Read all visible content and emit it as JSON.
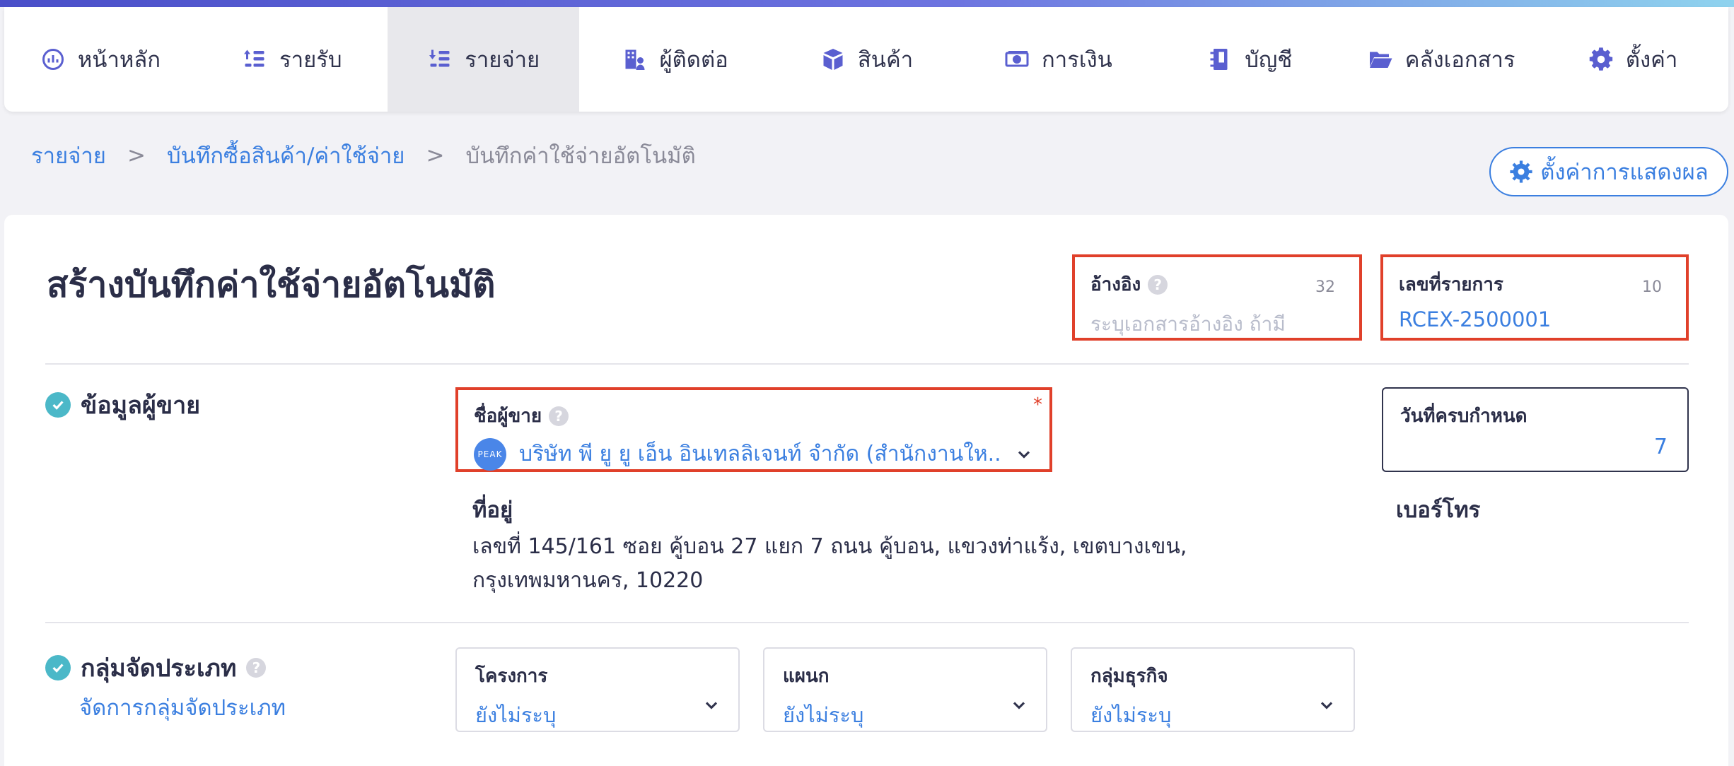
{
  "nav": {
    "items": [
      {
        "label": "หน้าหลัก",
        "icon": "dashboard-icon"
      },
      {
        "label": "รายรับ",
        "icon": "income-icon"
      },
      {
        "label": "รายจ่าย",
        "icon": "expense-icon",
        "active": true
      },
      {
        "label": "ผู้ติดต่อ",
        "icon": "contacts-icon"
      },
      {
        "label": "สินค้า",
        "icon": "product-box-icon"
      },
      {
        "label": "การเงิน",
        "icon": "money-icon"
      },
      {
        "label": "บัญชี",
        "icon": "ledger-icon"
      },
      {
        "label": "คลังเอกสาร",
        "icon": "folder-icon"
      },
      {
        "label": "ตั้งค่า",
        "icon": "gear-icon"
      }
    ]
  },
  "breadcrumb": {
    "items": [
      "รายจ่าย",
      "บันทึกซื้อสินค้า/ค่าใช้จ่าย",
      "บันทึกค่าใช้จ่ายอัตโนมัติ"
    ],
    "separator": ">"
  },
  "display_settings_label": "ตั้งค่าการแสดงผล",
  "page_title": "สร้างบันทึกค่าใช้จ่ายอัตโนมัติ",
  "reference": {
    "label": "อ้างอิง",
    "counter": "32",
    "placeholder": "ระบุเอกสารอ้างอิง ถ้ามี"
  },
  "transaction_no": {
    "label": "เลขที่รายการ",
    "counter": "10",
    "value": "RCEX-2500001"
  },
  "vendor_section": {
    "title": "ข้อมูลผู้ขาย",
    "vendor_label": "ชื่อผู้ขาย",
    "required": "*",
    "vendor_logo_text": "PEAK",
    "vendor_name": "บริษัท พี ยู ยู เอ็น อินเทลลิเจนท์ จำกัด (สำนักงานให...",
    "address_label": "ที่อยู่",
    "address_value": "เลขที่ 145/161 ซอย คู้บอน 27 แยก 7 ถนน คู้บอน, แขวงท่าแร้ง, เขตบางเขน, กรุงเทพมหานคร, 10220",
    "due_label": "วันที่ครบกำหนด",
    "due_value": "7",
    "phone_label": "เบอร์โทร"
  },
  "classification": {
    "title": "กลุ่มจัดประเภท",
    "manage_link": "จัดการกลุ่มจัดประเภท",
    "fields": [
      {
        "label": "โครงการ",
        "value": "ยังไม่ระบุ"
      },
      {
        "label": "แผนก",
        "value": "ยังไม่ระบุ"
      },
      {
        "label": "กลุ่มธุรกิจ",
        "value": "ยังไม่ระบุ"
      }
    ]
  },
  "colors": {
    "accent": "#3b7fe0",
    "highlight_border": "#e0402a",
    "check": "#4bb8c8",
    "nav_icon": "#5a5fd0"
  }
}
